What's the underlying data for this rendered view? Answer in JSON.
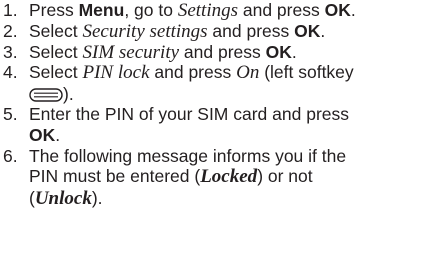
{
  "steps": [
    {
      "number": "1.",
      "parts": [
        "Press ",
        "Menu",
        ", go to ",
        "Settings",
        " and press ",
        "OK",
        "."
      ]
    },
    {
      "number": "2.",
      "parts": [
        "Select ",
        "Security settings",
        " and press ",
        "OK",
        "."
      ]
    },
    {
      "number": "3.",
      "parts": [
        "Select ",
        "SIM security",
        " and press ",
        "OK",
        "."
      ]
    },
    {
      "number": "4.",
      "parts": [
        "Select ",
        "PIN lock",
        " and press ",
        "On",
        " (left softkey",
        ")."
      ],
      "icon": "left-softkey-icon"
    },
    {
      "number": "5.",
      "parts": [
        "Enter the PIN of your SIM card and press",
        "OK",
        "."
      ]
    },
    {
      "number": "6.",
      "parts": [
        "The following message informs you if the",
        "PIN must be entered (",
        "Locked",
        ") or not",
        "(",
        "Unlock",
        ")."
      ]
    }
  ]
}
